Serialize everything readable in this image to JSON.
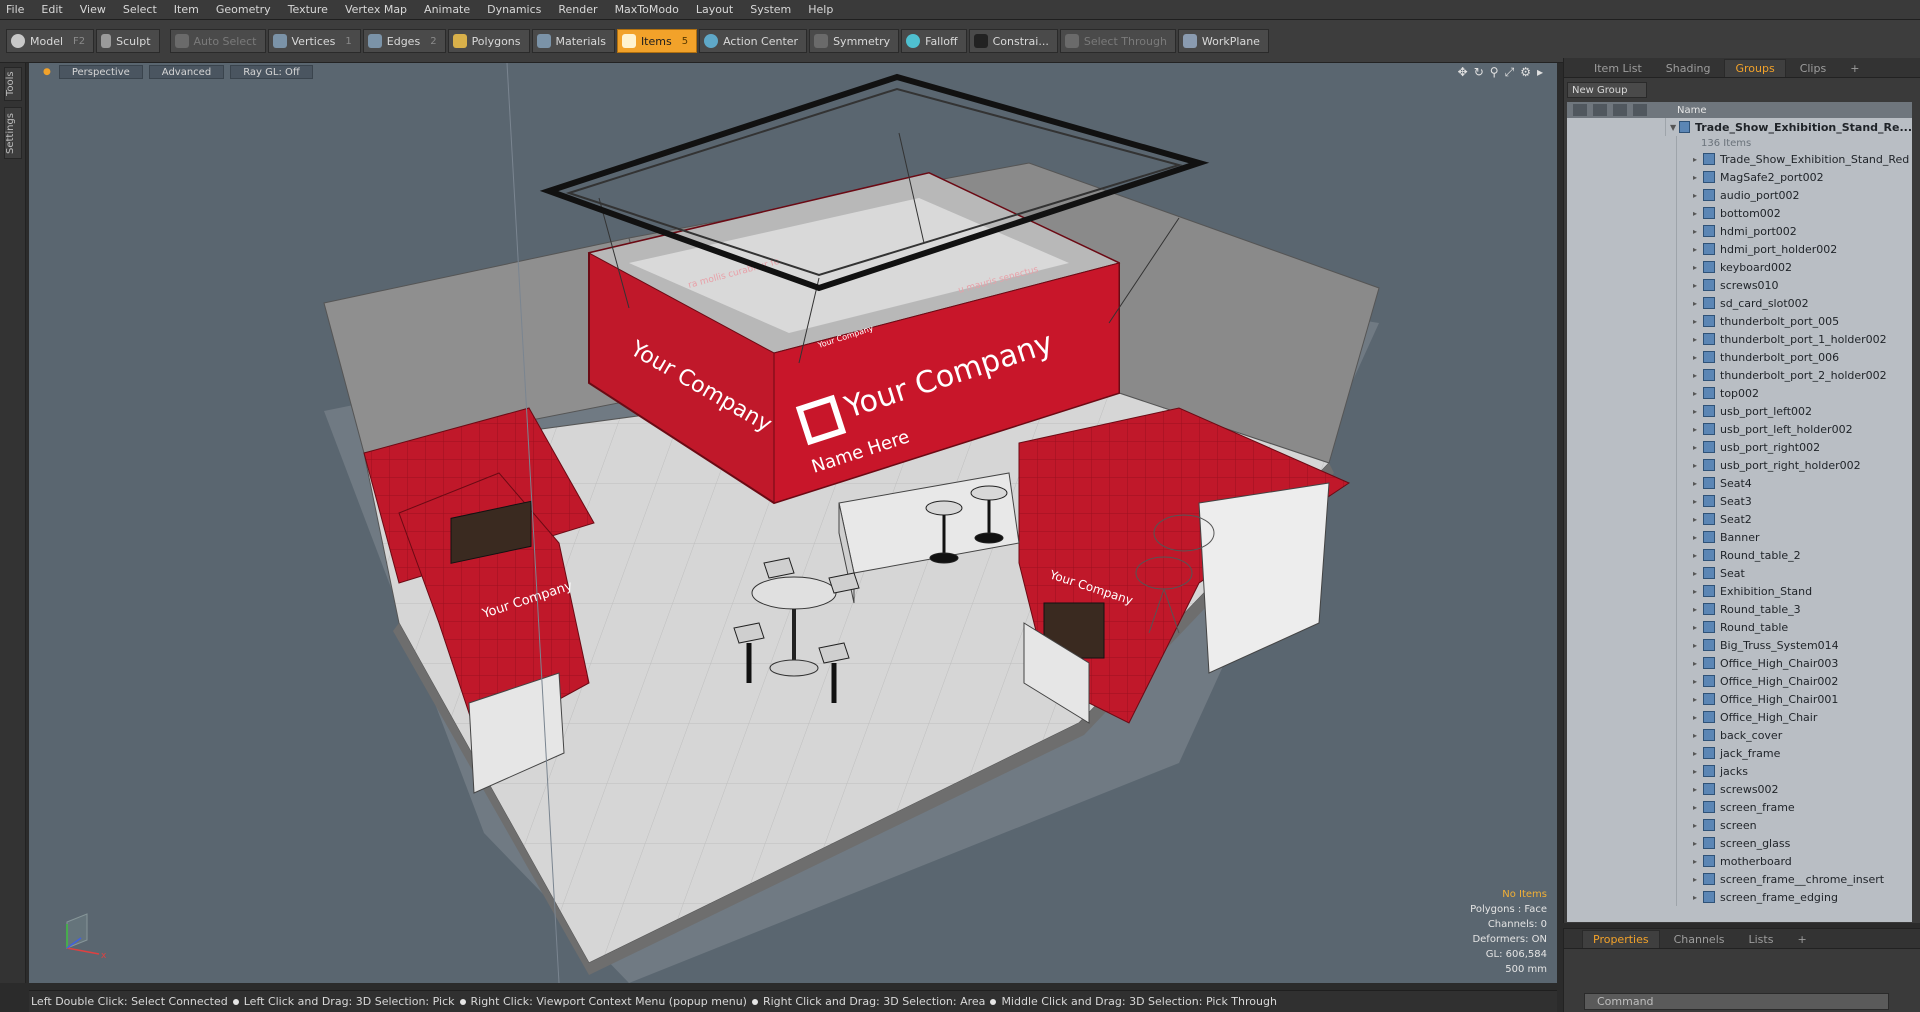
{
  "menu": [
    "File",
    "Edit",
    "View",
    "Select",
    "Item",
    "Geometry",
    "Texture",
    "Vertex Map",
    "Animate",
    "Dynamics",
    "Render",
    "MaxToModo",
    "Layout",
    "System",
    "Help"
  ],
  "toolbar": {
    "model": "Model",
    "model_key": "F2",
    "sculpt": "Sculpt",
    "auto_select": "Auto Select",
    "vertices": "Vertices",
    "vertices_key": "1",
    "edges": "Edges",
    "edges_key": "2",
    "polygons": "Polygons",
    "materials": "Materials",
    "items": "Items",
    "items_key": "5",
    "action_center": "Action Center",
    "symmetry": "Symmetry",
    "falloff": "Falloff",
    "constrain": "Constrai...",
    "select_through": "Select Through",
    "workplane": "WorkPlane"
  },
  "lefttabs": {
    "tools": "Tools",
    "settings": "Settings"
  },
  "viewport": {
    "perspective": "Perspective",
    "advanced": "Advanced",
    "raygl": "Ray GL: Off",
    "info": {
      "no_items": "No Items",
      "polygons": "Polygons : Face",
      "channels": "Channels: 0",
      "deformers": "Deformers: ON",
      "gl": "GL: 606,584",
      "scale": "500 mm"
    },
    "banner_main": "Your Company",
    "banner_sub": "Name Here",
    "banner_side": "Your Company",
    "banner_small": "Your Company",
    "banner_small2": "Your Company",
    "banner_small3": "Your Company",
    "banner_top_text": "ra mollis curabitur fe",
    "banner_top_text2": "u mauris senectus"
  },
  "right": {
    "tabs": [
      "Item List",
      "Shading",
      "Groups",
      "Clips"
    ],
    "new_group": "New Group",
    "col_name": "Name",
    "root": "Trade_Show_Exhibition_Stand_Re...",
    "root_count": "136 Items",
    "items": [
      "Trade_Show_Exhibition_Stand_Red",
      "MagSafe2_port002",
      "audio_port002",
      "bottom002",
      "hdmi_port002",
      "hdmi_port_holder002",
      "keyboard002",
      "screws010",
      "sd_card_slot002",
      "thunderbolt_port_005",
      "thunderbolt_port_1_holder002",
      "thunderbolt_port_006",
      "thunderbolt_port_2_holder002",
      "top002",
      "usb_port_left002",
      "usb_port_left_holder002",
      "usb_port_right002",
      "usb_port_right_holder002",
      "Seat4",
      "Seat3",
      "Seat2",
      "Banner",
      "Round_table_2",
      "Seat",
      "Exhibition_Stand",
      "Round_table_3",
      "Round_table",
      "Big_Truss_System014",
      "Office_High_Chair003",
      "Office_High_Chair002",
      "Office_High_Chair001",
      "Office_High_Chair",
      "back_cover",
      "jack_frame",
      "jacks",
      "screws002",
      "screen_frame",
      "screen",
      "screen_glass",
      "motherboard",
      "screen_frame__chrome_insert",
      "screen_frame_edging"
    ],
    "bottom_tabs": [
      "Properties",
      "Channels",
      "Lists"
    ],
    "command_placeholder": "Command"
  },
  "status": [
    "Left Double Click: Select Connected",
    "Left Click and Drag: 3D Selection: Pick",
    "Right Click: Viewport Context Menu (popup menu)",
    "Right Click and Drag: 3D Selection: Area",
    "Middle Click and Drag: 3D Selection: Pick Through"
  ],
  "colors": {
    "accent": "#f2a22a",
    "booth_red": "#c0182a"
  }
}
